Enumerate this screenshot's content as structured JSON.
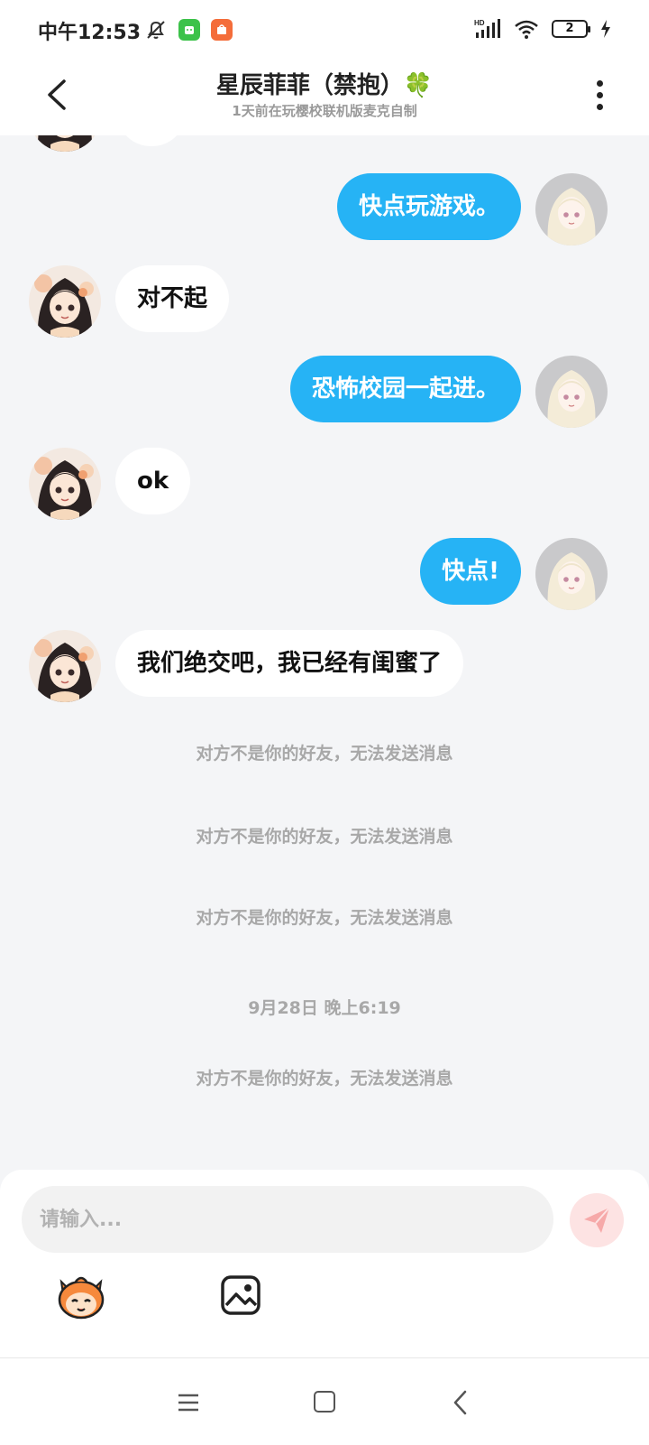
{
  "status": {
    "time": "中午12:53",
    "network": "HD",
    "battery": "2"
  },
  "header": {
    "title": "星辰菲菲（禁抱）🍀",
    "subtitle": "1天前在玩樱校联机版麦克自制"
  },
  "messages": [
    {
      "side": "out",
      "text": "快点玩游戏。"
    },
    {
      "side": "in",
      "text": "对不起"
    },
    {
      "side": "out",
      "text": "恐怖校园一起进。"
    },
    {
      "side": "in",
      "text": "ok"
    },
    {
      "side": "out",
      "text": "快点!"
    },
    {
      "side": "in",
      "text": "我们绝交吧，我已经有闺蜜了"
    }
  ],
  "system": {
    "notice_1": "对方不是你的好友，无法发送消息",
    "notice_2": "对方不是你的好友，无法发送消息",
    "notice_3": "对方不是你的好友，无法发送消息",
    "timestamp": "9月28日 晚上6:19",
    "notice_4": "对方不是你的好友，无法发送消息"
  },
  "composer": {
    "placeholder": "请输入..."
  },
  "colors": {
    "outgoing_bubble": "#26b3f5",
    "incoming_bubble": "#ffffff",
    "background": "#f4f5f7",
    "send_button": "#fde3e3"
  },
  "icons": [
    "muted-bell-icon",
    "signal-icon",
    "wifi-icon",
    "battery-icon",
    "charging-icon",
    "back-icon",
    "more-icon",
    "send-icon",
    "emoji-mascot-icon",
    "image-icon",
    "menu-icon",
    "home-icon",
    "nav-back-icon"
  ]
}
